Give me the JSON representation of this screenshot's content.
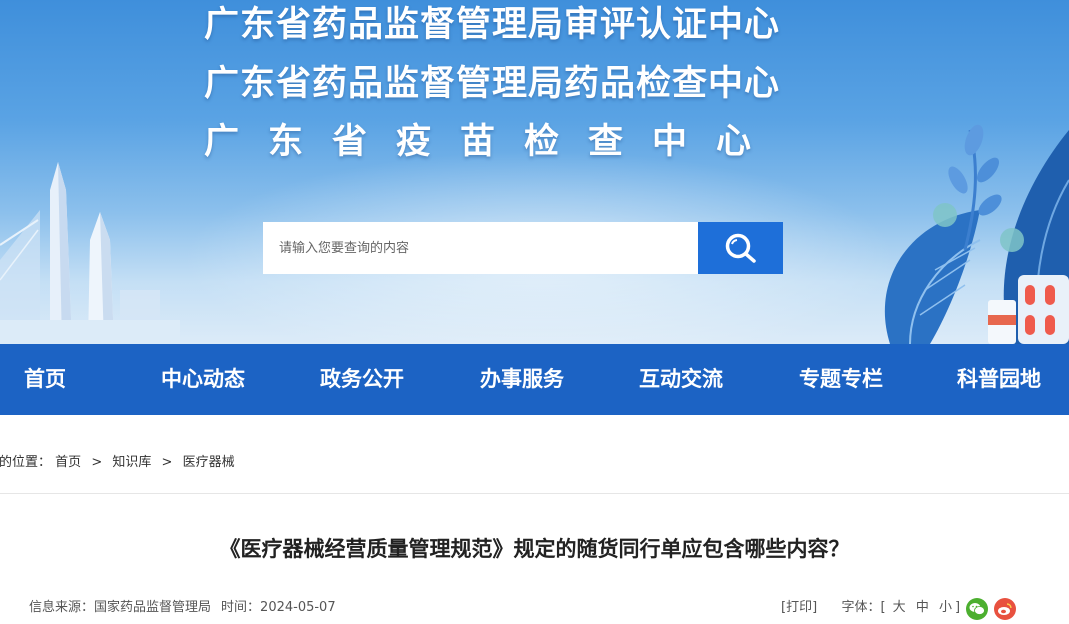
{
  "banner": {
    "titles": [
      "广东省药品监督管理局审评认证中心",
      "广东省药品监督管理局药品检查中心",
      "广东省疫苗检查中心"
    ]
  },
  "search": {
    "placeholder": "请输入您要查询的内容",
    "icon": "search-icon"
  },
  "nav": {
    "items": [
      "首页",
      "中心动态",
      "政务公开",
      "办事服务",
      "互动交流",
      "专题专栏",
      "科普园地"
    ]
  },
  "breadcrumb": {
    "prefix": "您的位置：",
    "items": [
      "首页",
      "知识库",
      "医疗器械"
    ],
    "separator": ">"
  },
  "article": {
    "title": "《医疗器械经营质量管理规范》规定的随货同行单应包含哪些内容？",
    "source_label": "信息来源：",
    "source": "国家药品监督管理局",
    "time_label": "时间：",
    "time": "2024-05-07",
    "print_label": "[打印]",
    "font_label": "字体：[",
    "font_large": "大",
    "font_medium": "中",
    "font_small": "小",
    "font_close": "]",
    "share_icons": [
      "wechat-icon",
      "weibo-icon"
    ]
  },
  "colors": {
    "nav_bg": "#1c63c4",
    "search_button": "#1e6fd9",
    "wechat": "#4caf2f",
    "weibo": "#e8513f"
  }
}
